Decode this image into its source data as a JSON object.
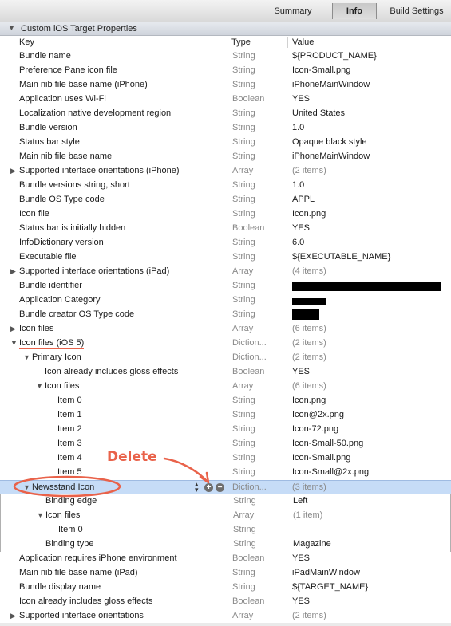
{
  "tabs": [
    {
      "label": "Summary",
      "active": false
    },
    {
      "label": "Info",
      "active": true
    },
    {
      "label": "Build Settings",
      "active": false
    }
  ],
  "section": {
    "title": "Custom iOS Target Properties"
  },
  "columns": {
    "key": "Key",
    "type": "Type",
    "value": "Value"
  },
  "annotation": {
    "text": "Delete",
    "color": "#e9624a"
  },
  "rows": [
    {
      "key": "Bundle name",
      "type": "String",
      "value": "${PRODUCT_NAME}",
      "indent": 0,
      "disclosure": "none"
    },
    {
      "key": "Preference Pane icon file",
      "type": "String",
      "value": "Icon-Small.png",
      "indent": 0,
      "disclosure": "none"
    },
    {
      "key": "Main nib file base name (iPhone)",
      "type": "String",
      "value": "iPhoneMainWindow",
      "indent": 0,
      "disclosure": "none"
    },
    {
      "key": "Application uses Wi-Fi",
      "type": "Boolean",
      "value": "YES",
      "indent": 0,
      "disclosure": "none"
    },
    {
      "key": "Localization native development region",
      "type": "String",
      "value": "United States",
      "indent": 0,
      "disclosure": "none"
    },
    {
      "key": "Bundle version",
      "type": "String",
      "value": "1.0",
      "indent": 0,
      "disclosure": "none"
    },
    {
      "key": "Status bar style",
      "type": "String",
      "value": "Opaque black style",
      "indent": 0,
      "disclosure": "none"
    },
    {
      "key": "Main nib file base name",
      "type": "String",
      "value": "iPhoneMainWindow",
      "indent": 0,
      "disclosure": "none"
    },
    {
      "key": "Supported interface orientations (iPhone)",
      "type": "Array",
      "value": "(2 items)",
      "indent": 0,
      "disclosure": "closed"
    },
    {
      "key": "Bundle versions string, short",
      "type": "String",
      "value": "1.0",
      "indent": 0,
      "disclosure": "none"
    },
    {
      "key": "Bundle OS Type code",
      "type": "String",
      "value": "APPL",
      "indent": 0,
      "disclosure": "none"
    },
    {
      "key": "Icon file",
      "type": "String",
      "value": "Icon.png",
      "indent": 0,
      "disclosure": "none"
    },
    {
      "key": "Status bar is initially hidden",
      "type": "Boolean",
      "value": "YES",
      "indent": 0,
      "disclosure": "none"
    },
    {
      "key": "InfoDictionary version",
      "type": "String",
      "value": "6.0",
      "indent": 0,
      "disclosure": "none"
    },
    {
      "key": "Executable file",
      "type": "String",
      "value": "${EXECUTABLE_NAME}",
      "indent": 0,
      "disclosure": "none"
    },
    {
      "key": "Supported interface orientations (iPad)",
      "type": "Array",
      "value": "(4 items)",
      "indent": 0,
      "disclosure": "closed"
    },
    {
      "key": "Bundle identifier",
      "type": "String",
      "value": "",
      "indent": 0,
      "disclosure": "none",
      "redacted": 1
    },
    {
      "key": "Application Category",
      "type": "String",
      "value": "",
      "indent": 0,
      "disclosure": "none",
      "redacted": 2
    },
    {
      "key": "Bundle creator OS Type code",
      "type": "String",
      "value": "",
      "indent": 0,
      "disclosure": "none",
      "redacted": 3
    },
    {
      "key": "Icon files",
      "type": "Array",
      "value": "(6 items)",
      "indent": 0,
      "disclosure": "closed"
    },
    {
      "key": "Icon files (iOS 5)",
      "type": "Diction...",
      "value": "(2 items)",
      "indent": 0,
      "disclosure": "open",
      "underline": true
    },
    {
      "key": "Primary Icon",
      "type": "Diction...",
      "value": "(2 items)",
      "indent": 1,
      "disclosure": "open"
    },
    {
      "key": "Icon already includes gloss effects",
      "type": "Boolean",
      "value": "YES",
      "indent": 2,
      "disclosure": "none"
    },
    {
      "key": "Icon files",
      "type": "Array",
      "value": "(6 items)",
      "indent": 2,
      "disclosure": "open"
    },
    {
      "key": "Item 0",
      "type": "String",
      "value": "Icon.png",
      "indent": 3,
      "disclosure": "none"
    },
    {
      "key": "Item 1",
      "type": "String",
      "value": "Icon@2x.png",
      "indent": 3,
      "disclosure": "none"
    },
    {
      "key": "Item 2",
      "type": "String",
      "value": "Icon-72.png",
      "indent": 3,
      "disclosure": "none"
    },
    {
      "key": "Item 3",
      "type": "String",
      "value": "Icon-Small-50.png",
      "indent": 3,
      "disclosure": "none"
    },
    {
      "key": "Item 4",
      "type": "String",
      "value": "Icon-Small.png",
      "indent": 3,
      "disclosure": "none"
    },
    {
      "key": "Item 5",
      "type": "String",
      "value": "Icon-Small@2x.png",
      "indent": 3,
      "disclosure": "none"
    },
    {
      "key": "Newsstand Icon",
      "type": "Diction...",
      "value": "(3 items)",
      "indent": 1,
      "disclosure": "open",
      "selected": true
    },
    {
      "key": "Binding edge",
      "type": "String",
      "value": "Left",
      "indent": 2,
      "disclosure": "none",
      "grouped": true
    },
    {
      "key": "Icon files",
      "type": "Array",
      "value": "(1 item)",
      "indent": 2,
      "disclosure": "open",
      "grouped": true
    },
    {
      "key": "Item 0",
      "type": "String",
      "value": "",
      "indent": 3,
      "disclosure": "none",
      "grouped": true
    },
    {
      "key": "Binding type",
      "type": "String",
      "value": "Magazine",
      "indent": 2,
      "disclosure": "none",
      "grouped": true
    },
    {
      "key": "Application requires iPhone environment",
      "type": "Boolean",
      "value": "YES",
      "indent": 0,
      "disclosure": "none"
    },
    {
      "key": "Main nib file base name (iPad)",
      "type": "String",
      "value": "iPadMainWindow",
      "indent": 0,
      "disclosure": "none"
    },
    {
      "key": "Bundle display name",
      "type": "String",
      "value": "${TARGET_NAME}",
      "indent": 0,
      "disclosure": "none"
    },
    {
      "key": "Icon already includes gloss effects",
      "type": "Boolean",
      "value": "YES",
      "indent": 0,
      "disclosure": "none"
    },
    {
      "key": "Supported interface orientations",
      "type": "Array",
      "value": "(2 items)",
      "indent": 0,
      "disclosure": "closed"
    }
  ]
}
